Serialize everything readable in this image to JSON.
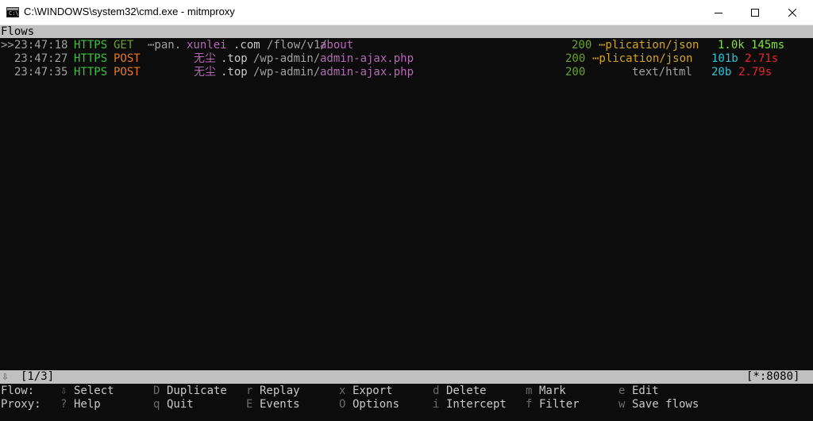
{
  "window": {
    "title": "C:\\WINDOWS\\system32\\cmd.exe - mitmproxy",
    "icon_text": "C:\\"
  },
  "header": {
    "label": "Flows"
  },
  "flows": [
    {
      "marker": ">>",
      "time": "23:47:18",
      "scheme": "HTTPS",
      "method": "GET",
      "host_prefix": "⋯pan.",
      "host_main": "xunlei",
      "host_suffix": ".com",
      "path_prefix": "/flow/v1/",
      "path_main": "about",
      "status": "200",
      "content_type": "⋯plication/json",
      "size": "1.0k",
      "duration": "145ms"
    },
    {
      "marker": "",
      "time": "23:47:27",
      "scheme": "HTTPS",
      "method": "POST",
      "host_prefix": "",
      "host_main": "无尘",
      "host_suffix": ".top",
      "path_prefix": "/wp-admin/",
      "path_main": "admin-ajax.php",
      "status": "200",
      "content_type": "⋯plication/json",
      "size": "101b",
      "duration": "2.71s"
    },
    {
      "marker": "",
      "time": "23:47:35",
      "scheme": "HTTPS",
      "method": "POST",
      "host_prefix": "",
      "host_main": "无尘",
      "host_suffix": ".top",
      "path_prefix": "/wp-admin/",
      "path_main": "admin-ajax.php",
      "status": "200",
      "content_type": "text/html",
      "size": "20b",
      "duration": "2.79s"
    }
  ],
  "statusbar": {
    "arrow": "⇩",
    "position": "[1/3]",
    "listen": "[*:8080]"
  },
  "keybindings": {
    "flow_label": "Flow:",
    "proxy_label": "Proxy:",
    "flow": [
      {
        "key": "⇩",
        "label": "Select"
      },
      {
        "key": "D",
        "label": "Duplicate"
      },
      {
        "key": "r",
        "label": "Replay"
      },
      {
        "key": "x",
        "label": "Export"
      },
      {
        "key": "d",
        "label": "Delete"
      },
      {
        "key": "m",
        "label": "Mark"
      },
      {
        "key": "e",
        "label": "Edit"
      }
    ],
    "proxy": [
      {
        "key": "?",
        "label": "Help"
      },
      {
        "key": "q",
        "label": "Quit"
      },
      {
        "key": "E",
        "label": "Events"
      },
      {
        "key": "O",
        "label": "Options"
      },
      {
        "key": "i",
        "label": "Intercept"
      },
      {
        "key": "f",
        "label": "Filter"
      },
      {
        "key": "w",
        "label": "Save flows"
      }
    ]
  },
  "colors": {
    "terminal_bg": "#0c0c0c",
    "bar_bg": "#c0c0c0",
    "scheme": "#3fbf3f",
    "method_post": "#e5781e",
    "path_highlight": "#b26ab2",
    "status_ok": "#6aa12a",
    "content_type": "#d4a517",
    "size_large": "#7fe13a",
    "size_small": "#29c6d8",
    "duration_slow": "#e8242f"
  }
}
